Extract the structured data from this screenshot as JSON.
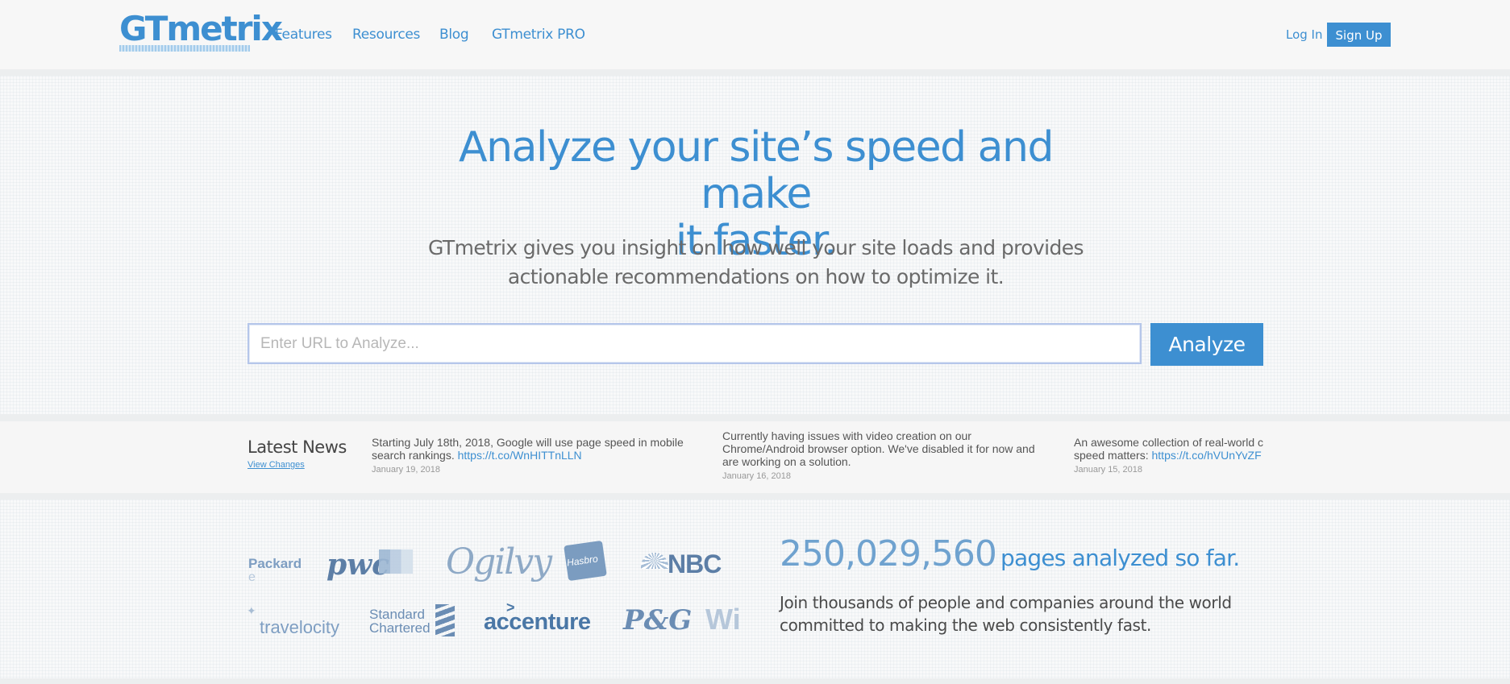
{
  "header": {
    "logo_text": "GTmetrix",
    "nav": [
      {
        "label": "Features"
      },
      {
        "label": "Resources"
      },
      {
        "label": "Blog"
      },
      {
        "label": "GTmetrix PRO"
      }
    ],
    "login_label": "Log In",
    "signup_label": "Sign Up"
  },
  "hero": {
    "title_line1": "Analyze your site’s speed and make",
    "title_line2": "it faster.",
    "subtitle_line1": "GTmetrix gives you insight on how well your site loads and provides",
    "subtitle_line2": "actionable recommendations on how to optimize it.",
    "url_placeholder": "Enter URL to Analyze...",
    "url_value": "",
    "analyze_label": "Analyze"
  },
  "news": {
    "heading": "Latest News",
    "view_changes": "View Changes",
    "items": [
      {
        "text": "Starting July 18th, 2018, Google will use page speed in mobile search rankings.",
        "link": "https://t.co/WnHITTnLLN",
        "date": "January 19, 2018"
      },
      {
        "text": "Currently having issues with video creation on our Chrome/Android browser option. We've disabled it for now and are working on a solution.",
        "link": "",
        "date": "January 16, 2018"
      },
      {
        "text": "An awesome collection of real-world c speed matters:",
        "link": "https://t.co/hVUnYvZF",
        "date": "January 15, 2018"
      }
    ]
  },
  "clients": {
    "brands": [
      {
        "name": "Packard"
      },
      {
        "name": "e"
      },
      {
        "name": "pwc"
      },
      {
        "name": "Ogilvy"
      },
      {
        "name": "Hasbro"
      },
      {
        "name": "NBC"
      },
      {
        "name": "travelocity"
      },
      {
        "name": "Standard"
      },
      {
        "name": "Chartered"
      },
      {
        "name": "accenture"
      },
      {
        "name": "P&G"
      },
      {
        "name": "Wi"
      }
    ],
    "count": "250,029,560",
    "count_suffix": "pages analyzed so far.",
    "join_line1": "Join thousands of people and companies around the world",
    "join_line2": "committed to making the web consistently fast."
  },
  "colors": {
    "accent": "#3d8fd1",
    "page_bg": "#f8f9fa",
    "news_bg": "#f6f6f6"
  }
}
